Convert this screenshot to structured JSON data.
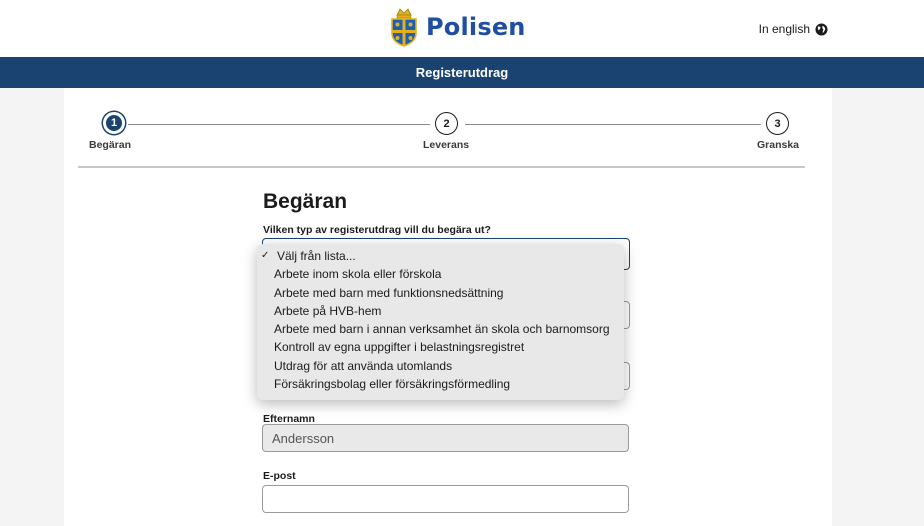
{
  "header": {
    "logo_text": "Polisen",
    "logo_icon": "police-crest-icon",
    "language_link": "In english",
    "language_icon": "globe-icon"
  },
  "band": {
    "title": "Registerutdrag"
  },
  "steps": [
    {
      "number": "1",
      "label": "Begäran",
      "active": true
    },
    {
      "number": "2",
      "label": "Leverans",
      "active": false
    },
    {
      "number": "3",
      "label": "Granska",
      "active": false
    }
  ],
  "form": {
    "title": "Begäran",
    "question": "Vilken typ av registerutdrag vill du begära ut?",
    "dropdown": {
      "options": [
        "Välj från lista...",
        "Arbete inom skola eller förskola",
        "Arbete med barn med funktionsnedsättning",
        "Arbete på HVB-hem",
        "Arbete med barn i annan verksamhet än skola och barnomsorg",
        "Kontroll av egna uppgifter i belastningsregistret",
        "Utdrag för att använda utomlands",
        "Försäkringsbolag eller försäkringsförmedling"
      ],
      "selected_index": 0,
      "check_mark": "✓"
    },
    "efternamn": {
      "label": "Efternamn",
      "value": "Andersson"
    },
    "epost": {
      "label": "E-post",
      "value": ""
    }
  },
  "colors": {
    "brand_blue": "#1b4371",
    "logo_blue": "#1f4ea3",
    "crest_gold": "#e3b11f"
  }
}
